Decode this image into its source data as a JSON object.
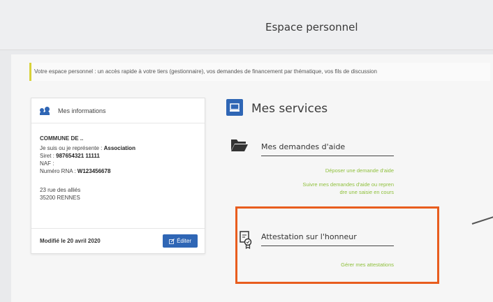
{
  "header": {
    "title": "Espace personnel"
  },
  "intro": {
    "text": "Votre espace personnel : un accès rapide à votre tiers (gestionnaire), vos demandes de financement par thématique, vos fils de discussion"
  },
  "info_card": {
    "title": "Mes informations",
    "org_name": "COMMUNE DE ..",
    "represent_label": "Je suis ou je représente : ",
    "represent_value": "Association",
    "siret_label": "Siret : ",
    "siret_value": "987654321 11111",
    "naf_label": "NAF :",
    "rna_label": "Numéro RNA : ",
    "rna_value": "W123456678",
    "address_line1": "23 rue des alliés",
    "address_line2": "35200 RENNES",
    "modified": "Modifié le 20 avril 2020",
    "edit_label": "Éditer"
  },
  "services": {
    "title": "Mes services",
    "demandes": {
      "title": "Mes demandes d'aide",
      "link1": "Déposer une demande d'aide",
      "link2_line1": "Suivre mes demandes d'aide ou repren",
      "link2_line2": "dre une saisie en cours"
    },
    "attestation": {
      "title": "Attestation sur l'honneur",
      "link": "Gérer mes attestations"
    }
  },
  "colors": {
    "accent": "#2f66b5",
    "link_green": "#8fc03c",
    "highlight": "#e85d1e",
    "intro_bar": "#d8d23a"
  },
  "icons": [
    "users-icon",
    "monitor-icon",
    "folder-open-icon",
    "certificate-icon",
    "edit-icon"
  ]
}
